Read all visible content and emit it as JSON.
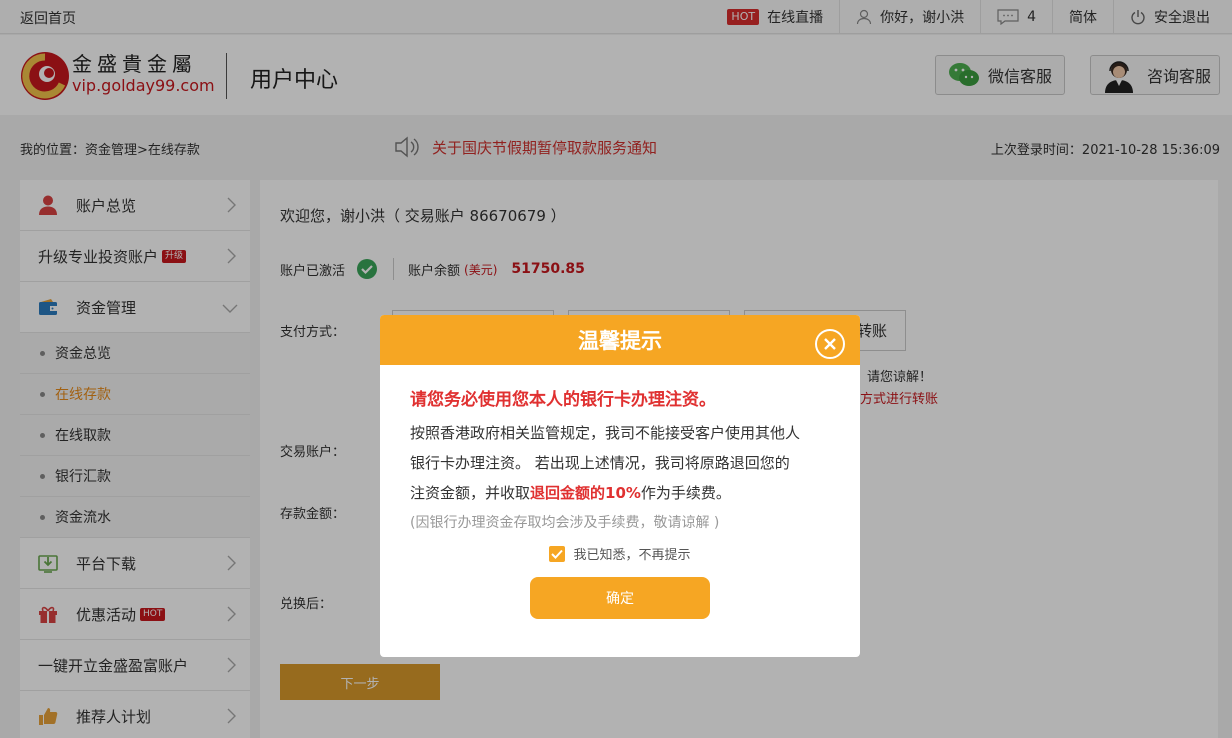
{
  "topbar": {
    "home": "返回首页",
    "hot": "HOT",
    "live": "在线直播",
    "greeting": "你好，谢小洪",
    "messages": "4",
    "lang": "简体",
    "logout": "安全退出"
  },
  "header": {
    "brand_cn": "金盛貴金屬",
    "brand_url": "vip.golday99.com",
    "title": "用户中心",
    "wechat": "微信客服",
    "consult": "咨询客服"
  },
  "crumb": {
    "path": "我的位置：资金管理>在线存款",
    "notice": "关于国庆节假期暂停取款服务通知",
    "last_login": "上次登录时间：2021-10-28 15:36:09"
  },
  "sidebar": {
    "items": [
      {
        "label": "账户总览"
      },
      {
        "label": "升级专业投资账户",
        "badge": "升级"
      },
      {
        "label": "资金管理"
      },
      {
        "label": "平台下载"
      },
      {
        "label": "优惠活动",
        "badge": "HOT"
      },
      {
        "label": "一键开立金盛盈富账户"
      },
      {
        "label": "推荐人计划"
      }
    ],
    "sub_items": [
      {
        "label": "资金总览"
      },
      {
        "label": "在线存款"
      },
      {
        "label": "在线取款"
      },
      {
        "label": "银行汇款"
      },
      {
        "label": "资金流水"
      }
    ]
  },
  "main": {
    "welcome": "欢迎您，谢小洪（ 交易账户 86670679 ）",
    "activated": "账户已激活",
    "balance_label": "账户余额",
    "currency": "(美元)",
    "balance": "51750.85",
    "pay_label": "支付方式：",
    "pay_opt3_fragment": "转账",
    "note1_fragment": "，请您谅解！",
    "note2_fragment": "方式进行转账",
    "account_label": "交易账户：",
    "amount_label": "存款金额：",
    "exchange_label": "兑换后：",
    "next": "下一步"
  },
  "modal": {
    "title": "温馨提示",
    "headline": "请您务必使用您本人的银行卡办理注资。",
    "para_1": "按照香港政府相关监管规定，我司不能接受客户使用其他人",
    "para_2": "银行卡办理注资。 若出现上述情况，我司将原路退回您的",
    "para_3_a": "注资金额，并收取",
    "para_3_hl": "退回金额的10%",
    "para_3_b": "作为手续费。",
    "note": "(因银行办理资金存取均会涉及手续费，敬请谅解 )",
    "checkbox": "我已知悉，不再提示",
    "confirm": "确定"
  },
  "colors": {
    "accent_orange": "#f6a623",
    "brand_red": "#c8181e",
    "highlight_red": "#e03131",
    "active_menu": "#e88b1a"
  }
}
